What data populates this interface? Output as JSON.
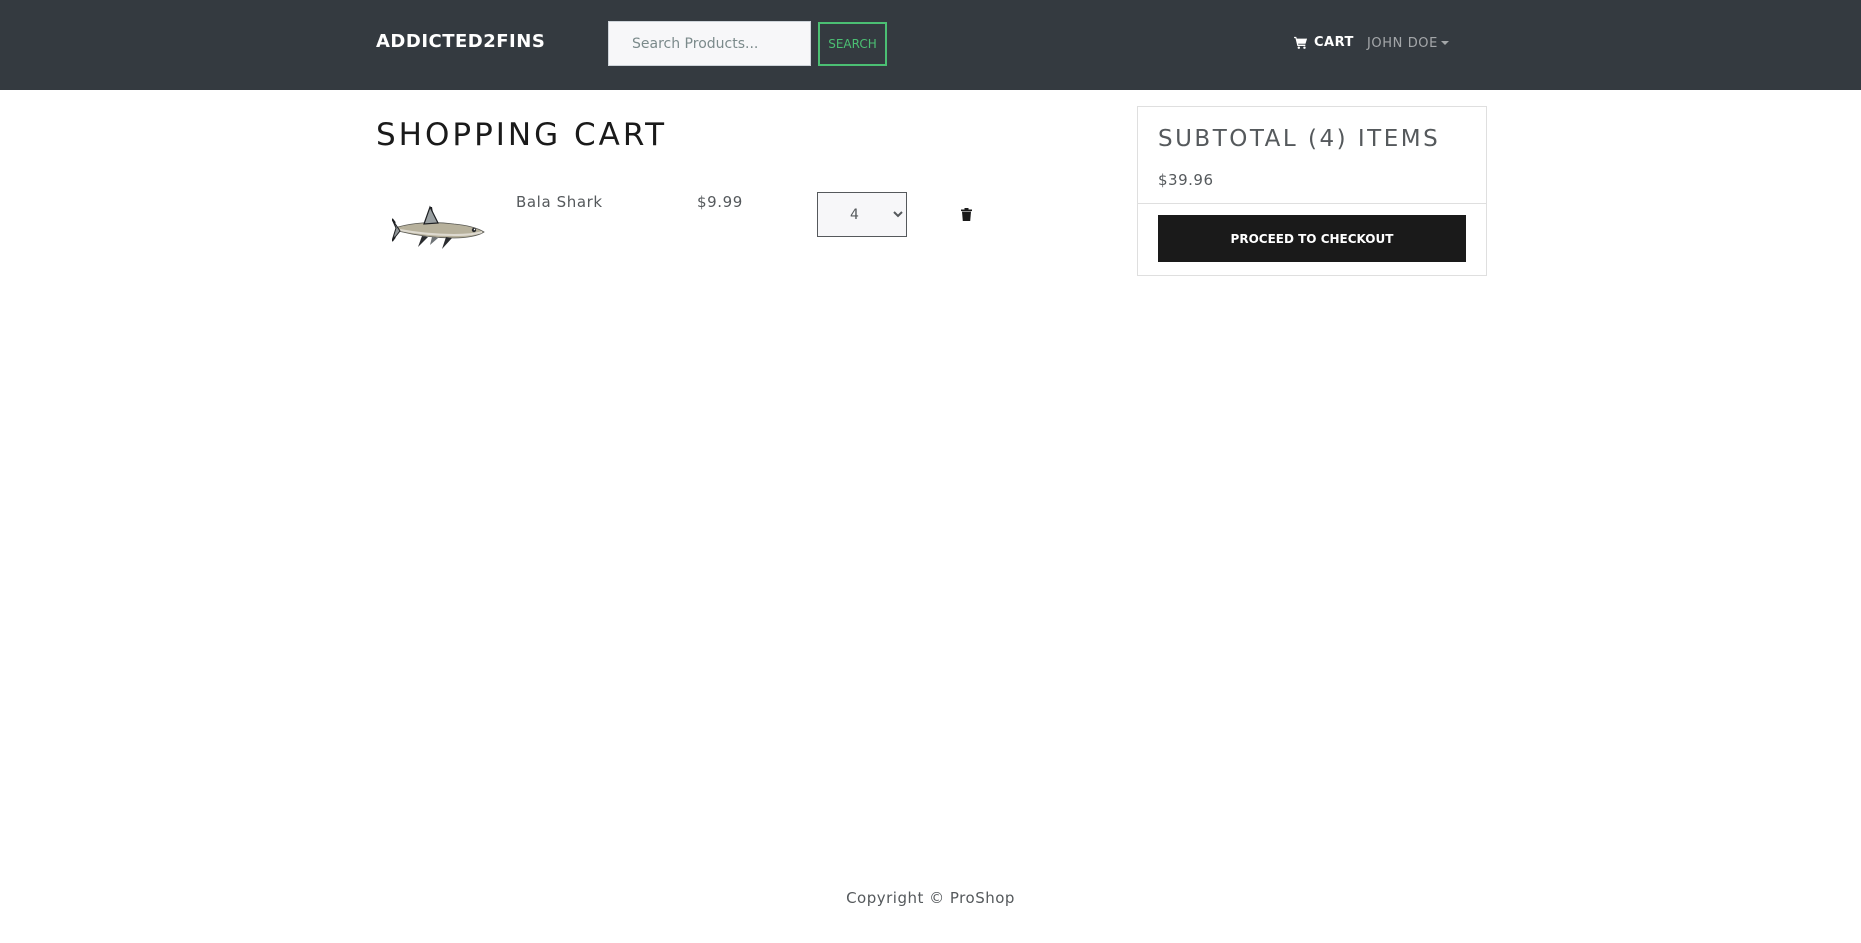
{
  "navbar": {
    "brand": "ADDICTED2FINS",
    "search_placeholder": "Search Products...",
    "search_button": "SEARCH",
    "cart_label": "CART",
    "cart_icon": "shopping-cart-icon",
    "user_name": "JOHN DOE",
    "user_caret_icon": "caret-down-icon"
  },
  "main": {
    "title": "SHOPPING CART",
    "items": [
      {
        "image_icon": "fish-shark-image",
        "name": "Bala Shark",
        "price": "$9.99",
        "quantity": "4",
        "delete_icon": "trash-icon"
      }
    ]
  },
  "summary": {
    "title": "SUBTOTAL (4) ITEMS",
    "total": "$39.96",
    "checkout_button": "PROCEED TO CHECKOUT"
  },
  "footer": {
    "copyright": "Copyright © ProShop"
  },
  "colors": {
    "navbar_bg": "#343a40",
    "accent_green": "#4bbf73",
    "checkout_bg": "#1a1a1a"
  }
}
